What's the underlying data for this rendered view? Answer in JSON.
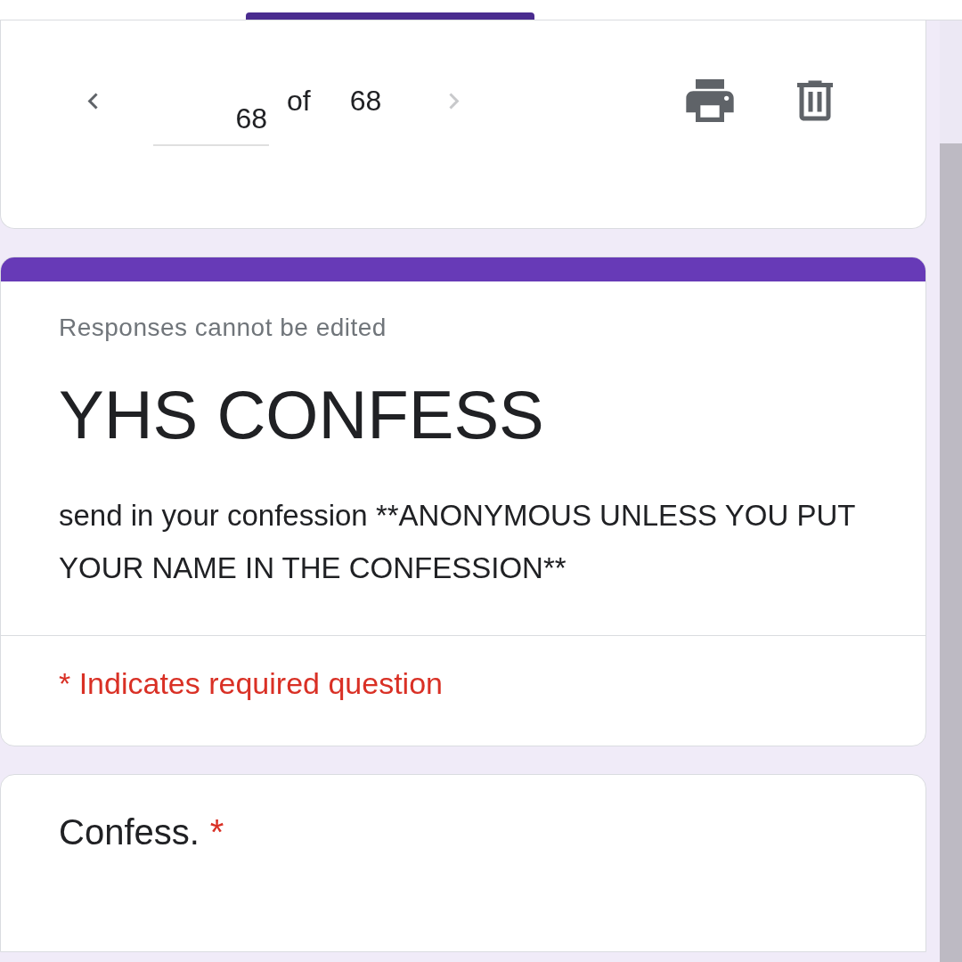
{
  "navigation": {
    "previous": {
      "disabled": false
    },
    "current": "68",
    "of_label": "of",
    "total": "68",
    "next": {
      "disabled": true
    }
  },
  "header": {
    "notice": "Responses cannot be edited",
    "title": "YHS CONFESS",
    "description": "send in your confession **ANONYMOUS UNLESS YOU PUT YOUR NAME IN THE CONFESSION**",
    "required_note": "* Indicates required question"
  },
  "question": {
    "title": "Confess.",
    "required": true,
    "required_mark": "*"
  }
}
